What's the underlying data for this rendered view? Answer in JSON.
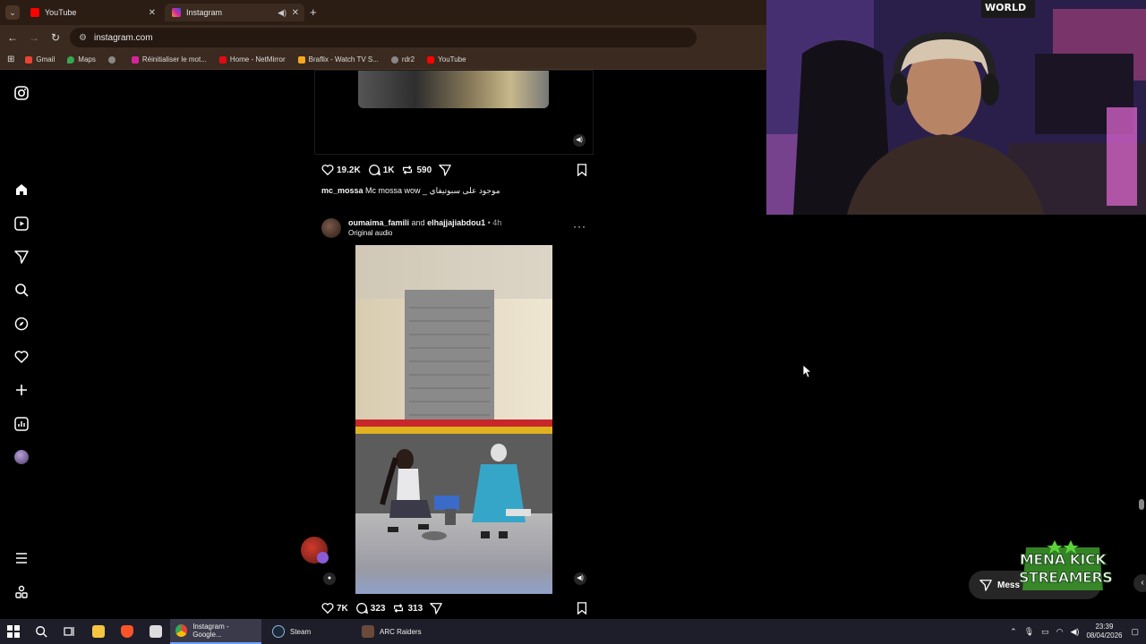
{
  "browser": {
    "tabs": [
      {
        "label": "YouTube",
        "color": "#ff0000"
      },
      {
        "label": "Instagram",
        "color": "#d6249f"
      }
    ],
    "url": "instagram.com",
    "bookmarks": [
      {
        "label": "Gmail",
        "color": "#ea4335"
      },
      {
        "label": "Maps",
        "color": "#34a853"
      },
      {
        "label": "",
        "color": "#888888"
      },
      {
        "label": "Réinitialiser le mot...",
        "color": "#d6249f"
      },
      {
        "label": "Home - NetMirror",
        "color": "#e50914"
      },
      {
        "label": "Braflix - Watch TV S...",
        "color": "#f5a623"
      },
      {
        "label": "rdr2",
        "color": "#888888"
      },
      {
        "label": "YouTube",
        "color": "#ff0000"
      }
    ]
  },
  "sidebar": {
    "items": [
      "instagram-icon",
      "home-icon",
      "reels-icon",
      "messages-icon",
      "search-icon",
      "explore-icon",
      "notifications-icon",
      "create-icon",
      "dashboard-icon",
      "profile-icon",
      "more-icon",
      "meta-icon"
    ]
  },
  "post1": {
    "likes": "19.2K",
    "comments": "1K",
    "reposts": "590",
    "caption_user": "mc_mossa",
    "caption_text": " Mc mossa wow _ موجود على سبوتيفاي"
  },
  "post2": {
    "user1": "oumaima_famili",
    "and": " and ",
    "user2": "elhajjajiabdou1",
    "time": " • 4h",
    "audio": "Original audio",
    "likes": "7K",
    "comments": "323",
    "reposts": "313"
  },
  "overlay": {
    "messages_label": "Mess",
    "mena_line1": "MENA KICK",
    "mena_line2": "STREAMERS",
    "webcam_sign": "WORLD"
  },
  "taskbar": {
    "items": [
      {
        "label": "Instagram - Google...",
        "color": "#4285f4"
      },
      {
        "label": "Steam",
        "color": "#1b2838"
      },
      {
        "label": "ARC Raiders",
        "color": "#6b4a3a"
      }
    ],
    "time": "23:39",
    "date": "08/04/2026"
  }
}
